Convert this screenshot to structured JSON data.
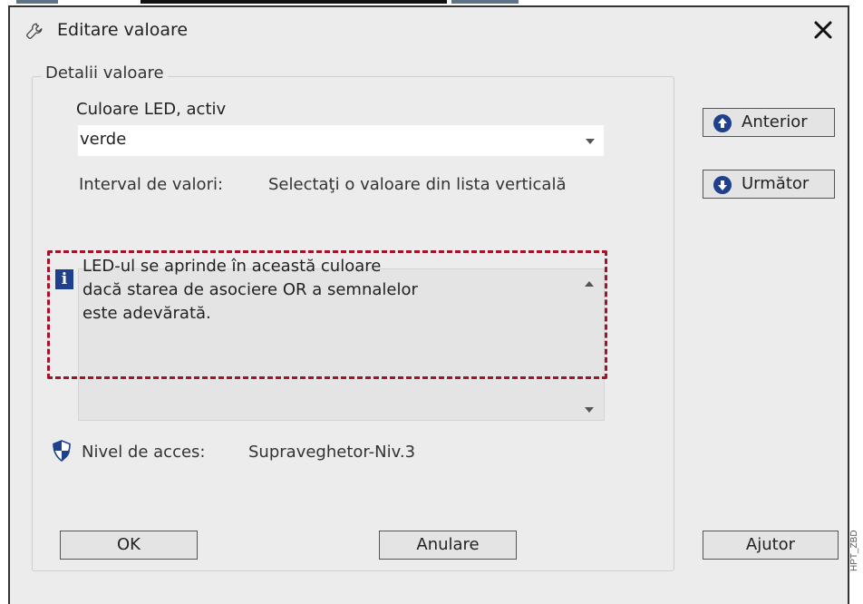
{
  "dialog": {
    "title": "Editare valoare",
    "group_title": "Detalii valoare",
    "parameter_label": "Culoare LED, activ",
    "selected_value": "verde",
    "range_label": "Interval de valori:",
    "range_value": "Selectaţi o valoare din lista verticală",
    "info_lines": [
      "LED-ul se aprinde în această culoare",
      "dacă starea de asociere OR a semnalelor",
      "este adevărată."
    ],
    "access_label": "Nivel de acces:",
    "access_value": "Supraveghetor-Niv.3"
  },
  "buttons": {
    "previous": "Anterior",
    "next": "Următor",
    "ok": "OK",
    "cancel": "Anulare",
    "help": "Ajutor"
  },
  "icons": {
    "title": "wrench-icon",
    "close": "close-icon",
    "info": "info-icon",
    "access": "shield-icon",
    "previous": "arrow-up-circle-icon",
    "next": "arrow-down-circle-icon"
  },
  "info_icon_glyph": "i",
  "side_label": "HPT_ZBD",
  "colors": {
    "accent": "#1f3f8f",
    "highlight": "#a3142a",
    "dialog_bg": "#ececec"
  }
}
